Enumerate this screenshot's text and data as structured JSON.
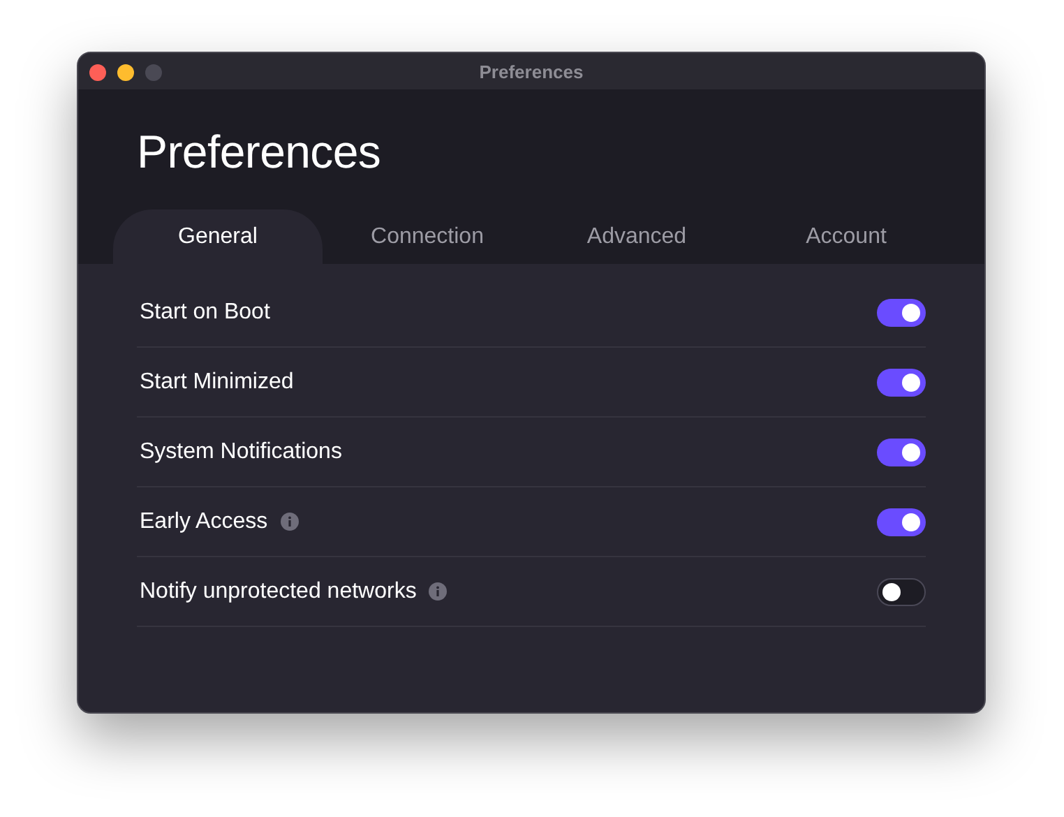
{
  "window": {
    "title": "Preferences"
  },
  "heading": "Preferences",
  "tabs": [
    {
      "label": "General",
      "selected": true
    },
    {
      "label": "Connection",
      "selected": false
    },
    {
      "label": "Advanced",
      "selected": false
    },
    {
      "label": "Account",
      "selected": false
    }
  ],
  "settings": [
    {
      "label": "Start on Boot",
      "info": false,
      "on": true
    },
    {
      "label": "Start Minimized",
      "info": false,
      "on": true
    },
    {
      "label": "System Notifications",
      "info": false,
      "on": true
    },
    {
      "label": "Early Access",
      "info": true,
      "on": true
    },
    {
      "label": "Notify unprotected networks",
      "info": true,
      "on": false
    }
  ]
}
